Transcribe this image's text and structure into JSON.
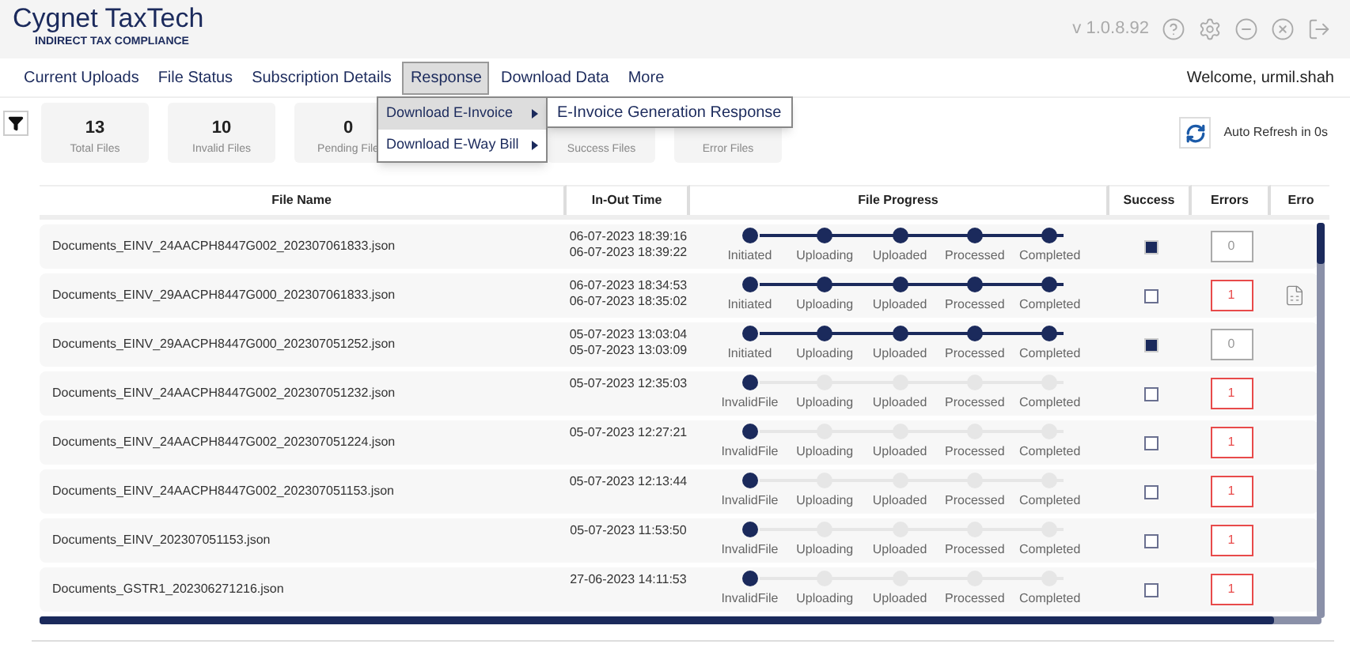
{
  "header": {
    "logo_title": "Cygnet TaxTech",
    "logo_subtitle": "INDIRECT TAX COMPLIANCE",
    "version": "v 1.0.8.92"
  },
  "nav": [
    {
      "label": "Current Uploads",
      "selected": false
    },
    {
      "label": "File Status",
      "selected": false
    },
    {
      "label": "Subscription Details",
      "selected": false
    },
    {
      "label": "Response",
      "selected": true
    },
    {
      "label": "Download Data",
      "selected": false
    },
    {
      "label": "More",
      "selected": false
    }
  ],
  "welcome": "Welcome, urmil.shah",
  "response_menu": [
    {
      "label": "Download E-Invoice",
      "selected": true
    },
    {
      "label": "Download E-Way Bill",
      "selected": false
    }
  ],
  "submenu": [
    "E-Invoice Generation Response"
  ],
  "stats": [
    {
      "value": "13",
      "label": "Total Files"
    },
    {
      "value": "10",
      "label": "Invalid Files"
    },
    {
      "value": "0",
      "label": "Pending File"
    },
    {
      "label": "Success Files"
    },
    {
      "label": "Error Files"
    }
  ],
  "auto_refresh": "Auto Refresh in 0s",
  "table": {
    "columns": [
      "File Name",
      "In-Out Time",
      "File Progress",
      "Success",
      "Errors",
      "Erro"
    ],
    "rows": [
      {
        "file": "Documents_EINV_24AACPH8447G002_202307061833.json",
        "times": [
          "06-07-2023 18:39:16",
          "06-07-2023 18:39:22"
        ],
        "steps": [
          {
            "label": "Initiated",
            "done": true
          },
          {
            "label": "Uploading",
            "done": true
          },
          {
            "label": "Uploaded",
            "done": true
          },
          {
            "label": "Processed",
            "done": true
          },
          {
            "label": "Completed",
            "done": true
          }
        ],
        "success": true,
        "errors": "0",
        "has_errors": false,
        "excel": false
      },
      {
        "file": "Documents_EINV_29AACPH8447G000_202307061833.json",
        "times": [
          "06-07-2023 18:34:53",
          "06-07-2023 18:35:02"
        ],
        "steps": [
          {
            "label": "Initiated",
            "done": true
          },
          {
            "label": "Uploading",
            "done": true
          },
          {
            "label": "Uploaded",
            "done": true
          },
          {
            "label": "Processed",
            "done": true
          },
          {
            "label": "Completed",
            "done": true
          }
        ],
        "success": false,
        "errors": "1",
        "has_errors": true,
        "excel": true
      },
      {
        "file": "Documents_EINV_29AACPH8447G000_202307051252.json",
        "times": [
          "05-07-2023 13:03:04",
          "05-07-2023 13:03:09"
        ],
        "steps": [
          {
            "label": "Initiated",
            "done": true
          },
          {
            "label": "Uploading",
            "done": true
          },
          {
            "label": "Uploaded",
            "done": true
          },
          {
            "label": "Processed",
            "done": true
          },
          {
            "label": "Completed",
            "done": true
          }
        ],
        "success": true,
        "errors": "0",
        "has_errors": false,
        "excel": false
      },
      {
        "file": "Documents_EINV_24AACPH8447G002_202307051232.json",
        "times": [
          "05-07-2023 12:35:03"
        ],
        "steps": [
          {
            "label": "InvalidFile",
            "done": true
          },
          {
            "label": "Uploading",
            "done": false
          },
          {
            "label": "Uploaded",
            "done": false
          },
          {
            "label": "Processed",
            "done": false
          },
          {
            "label": "Completed",
            "done": false
          }
        ],
        "success": false,
        "errors": "1",
        "has_errors": true,
        "excel": false
      },
      {
        "file": "Documents_EINV_24AACPH8447G002_202307051224.json",
        "times": [
          "05-07-2023 12:27:21"
        ],
        "steps": [
          {
            "label": "InvalidFile",
            "done": true
          },
          {
            "label": "Uploading",
            "done": false
          },
          {
            "label": "Uploaded",
            "done": false
          },
          {
            "label": "Processed",
            "done": false
          },
          {
            "label": "Completed",
            "done": false
          }
        ],
        "success": false,
        "errors": "1",
        "has_errors": true,
        "excel": false
      },
      {
        "file": "Documents_EINV_24AACPH8447G002_202307051153.json",
        "times": [
          "05-07-2023 12:13:44"
        ],
        "steps": [
          {
            "label": "InvalidFile",
            "done": true
          },
          {
            "label": "Uploading",
            "done": false
          },
          {
            "label": "Uploaded",
            "done": false
          },
          {
            "label": "Processed",
            "done": false
          },
          {
            "label": "Completed",
            "done": false
          }
        ],
        "success": false,
        "errors": "1",
        "has_errors": true,
        "excel": false
      },
      {
        "file": "Documents_EINV_202307051153.json",
        "times": [
          "05-07-2023 11:53:50"
        ],
        "steps": [
          {
            "label": "InvalidFile",
            "done": true
          },
          {
            "label": "Uploading",
            "done": false
          },
          {
            "label": "Uploaded",
            "done": false
          },
          {
            "label": "Processed",
            "done": false
          },
          {
            "label": "Completed",
            "done": false
          }
        ],
        "success": false,
        "errors": "1",
        "has_errors": true,
        "excel": false
      },
      {
        "file": "Documents_GSTR1_202306271216.json",
        "times": [
          "27-06-2023 14:11:53"
        ],
        "steps": [
          {
            "label": "InvalidFile",
            "done": true
          },
          {
            "label": "Uploading",
            "done": false
          },
          {
            "label": "Uploaded",
            "done": false
          },
          {
            "label": "Processed",
            "done": false
          },
          {
            "label": "Completed",
            "done": false
          }
        ],
        "success": false,
        "errors": "1",
        "has_errors": true,
        "excel": false
      }
    ]
  }
}
